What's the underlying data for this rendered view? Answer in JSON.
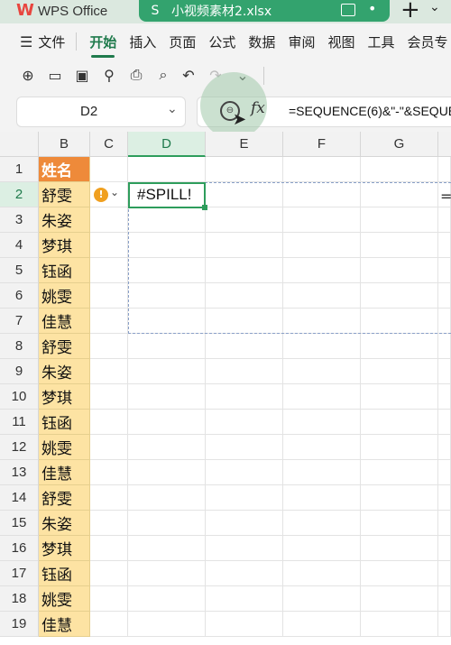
{
  "titlebar": {
    "app_name": "WPS Office",
    "doc_name": "小视频素材2.xlsx",
    "add_tab": "+"
  },
  "menubar": {
    "file_label": "文件",
    "items": [
      "开始",
      "插入",
      "页面",
      "公式",
      "数据",
      "审阅",
      "视图",
      "工具",
      "会员专"
    ]
  },
  "formula_bar": {
    "cell_ref": "D2",
    "fx_label": "fx",
    "formula": "=SEQUENCE(6)&\"-\"&SEQUE"
  },
  "sheet": {
    "columns": [
      "B",
      "C",
      "D",
      "E",
      "F",
      "G"
    ],
    "rows": [
      "1",
      "2",
      "3",
      "4",
      "5",
      "6",
      "7",
      "8",
      "9",
      "10",
      "11",
      "12",
      "13",
      "14",
      "15",
      "16",
      "17",
      "18",
      "19"
    ],
    "b_values": [
      "姓名",
      "舒雯",
      "朱姿",
      "梦琪",
      "钰函",
      "姚雯",
      "佳慧",
      "舒雯",
      "朱姿",
      "梦琪",
      "钰函",
      "姚雯",
      "佳慧",
      "舒雯",
      "朱姿",
      "梦琪",
      "钰函",
      "姚雯",
      "佳慧"
    ],
    "d2_value": "#SPILL!",
    "e_col_text": "=",
    "error_icon": "!",
    "selected_cell": "D2",
    "colors": {
      "header_orange": "#ee8a3a",
      "name_fill": "#fde3a3",
      "active_green": "#2e9d5c"
    }
  }
}
